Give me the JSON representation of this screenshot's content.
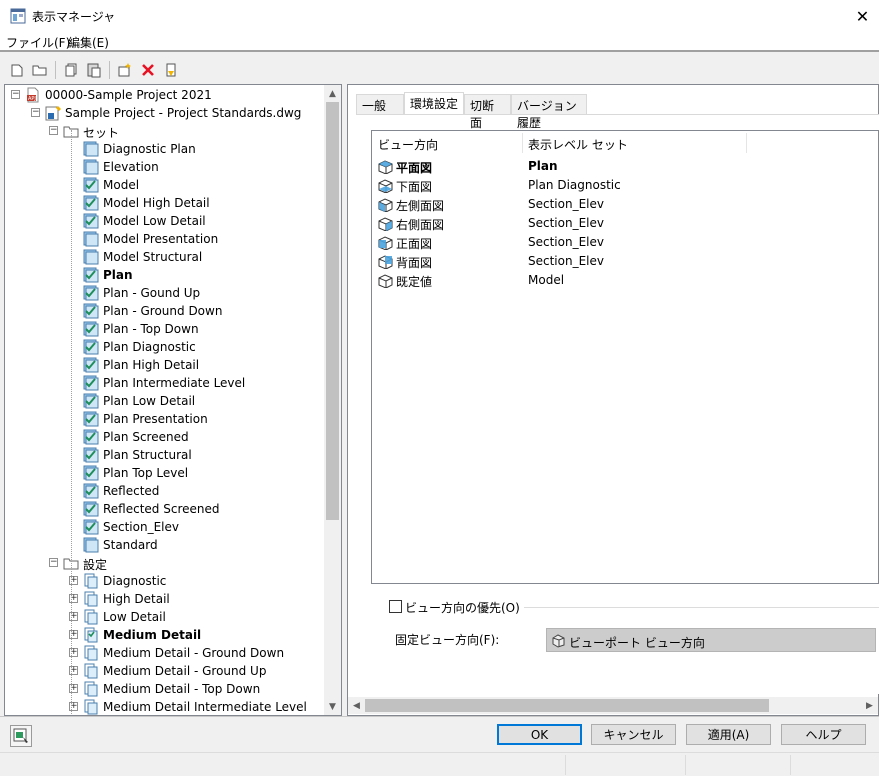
{
  "window": {
    "title": "表示マネージャ",
    "close_glyph": "✕"
  },
  "menu": {
    "items": [
      "ファイル(F)",
      "編集(E)"
    ]
  },
  "toolbar": {
    "buttons": [
      "new-icon",
      "open-icon",
      "copy-icon",
      "paste-icon",
      "new-set-icon",
      "delete-icon",
      "purge-icon"
    ],
    "delete_color": "#e81123"
  },
  "tree": {
    "project": "00000-Sample Project 2021",
    "drawing": "Sample Project - Project Standards.dwg",
    "sets_folder": "セット",
    "sets": [
      {
        "label": "Diagnostic Plan",
        "bold": false,
        "checked": false
      },
      {
        "label": "Elevation",
        "bold": false,
        "checked": false
      },
      {
        "label": "Model",
        "bold": false,
        "checked": true
      },
      {
        "label": "Model High Detail",
        "bold": false,
        "checked": true
      },
      {
        "label": "Model Low Detail",
        "bold": false,
        "checked": true
      },
      {
        "label": "Model Presentation",
        "bold": false,
        "checked": false
      },
      {
        "label": "Model Structural",
        "bold": false,
        "checked": false
      },
      {
        "label": "Plan",
        "bold": true,
        "checked": true
      },
      {
        "label": "Plan - Gound Up",
        "bold": false,
        "checked": true
      },
      {
        "label": "Plan - Ground Down",
        "bold": false,
        "checked": true
      },
      {
        "label": "Plan - Top Down",
        "bold": false,
        "checked": true
      },
      {
        "label": "Plan Diagnostic",
        "bold": false,
        "checked": true
      },
      {
        "label": "Plan High Detail",
        "bold": false,
        "checked": true
      },
      {
        "label": "Plan Intermediate Level",
        "bold": false,
        "checked": true
      },
      {
        "label": "Plan Low Detail",
        "bold": false,
        "checked": true
      },
      {
        "label": "Plan Presentation",
        "bold": false,
        "checked": true
      },
      {
        "label": "Plan Screened",
        "bold": false,
        "checked": true
      },
      {
        "label": "Plan Structural",
        "bold": false,
        "checked": true
      },
      {
        "label": "Plan Top Level",
        "bold": false,
        "checked": true
      },
      {
        "label": "Reflected",
        "bold": false,
        "checked": true
      },
      {
        "label": "Reflected Screened",
        "bold": false,
        "checked": true
      },
      {
        "label": "Section_Elev",
        "bold": false,
        "checked": true
      },
      {
        "label": "Standard",
        "bold": false,
        "checked": false
      }
    ],
    "configs_folder": "設定",
    "configs": [
      {
        "label": "Diagnostic",
        "bold": false
      },
      {
        "label": "High Detail",
        "bold": false
      },
      {
        "label": "Low Detail",
        "bold": false
      },
      {
        "label": "Medium Detail",
        "bold": true
      },
      {
        "label": "Medium Detail - Ground Down",
        "bold": false
      },
      {
        "label": "Medium Detail - Ground Up",
        "bold": false
      },
      {
        "label": "Medium Detail - Top Down",
        "bold": false
      },
      {
        "label": "Medium Detail Intermediate Level",
        "bold": false
      }
    ]
  },
  "tabs": [
    {
      "label": "一般",
      "active": false
    },
    {
      "label": "環境設定",
      "active": true
    },
    {
      "label": "切断面",
      "active": false
    },
    {
      "label": "バージョン履歴",
      "active": false
    }
  ],
  "listview": {
    "columns": [
      "ビュー方向",
      "表示レベル セット"
    ],
    "rows": [
      {
        "direction": "平面図",
        "set": "Plan",
        "bold": true
      },
      {
        "direction": "下面図",
        "set": "Plan Diagnostic",
        "bold": false
      },
      {
        "direction": "左側面図",
        "set": "Section_Elev",
        "bold": false
      },
      {
        "direction": "右側面図",
        "set": "Section_Elev",
        "bold": false
      },
      {
        "direction": "正面図",
        "set": "Section_Elev",
        "bold": false
      },
      {
        "direction": "背面図",
        "set": "Section_Elev",
        "bold": false
      },
      {
        "direction": "既定値",
        "set": "Model",
        "bold": false
      }
    ]
  },
  "override": {
    "checkbox_label": "ビュー方向の優先(O)",
    "checked": false,
    "fixed_label": "固定ビュー方向(F):",
    "fixed_value": "ビューポート ビュー方向"
  },
  "buttons": {
    "ok": "OK",
    "cancel": "キャンセル",
    "apply": "適用(A)",
    "help": "ヘルプ"
  },
  "colors": {
    "accent": "#0078d7",
    "icon_blue": "#4aa3df",
    "icon_check": "#1e8f5a"
  }
}
